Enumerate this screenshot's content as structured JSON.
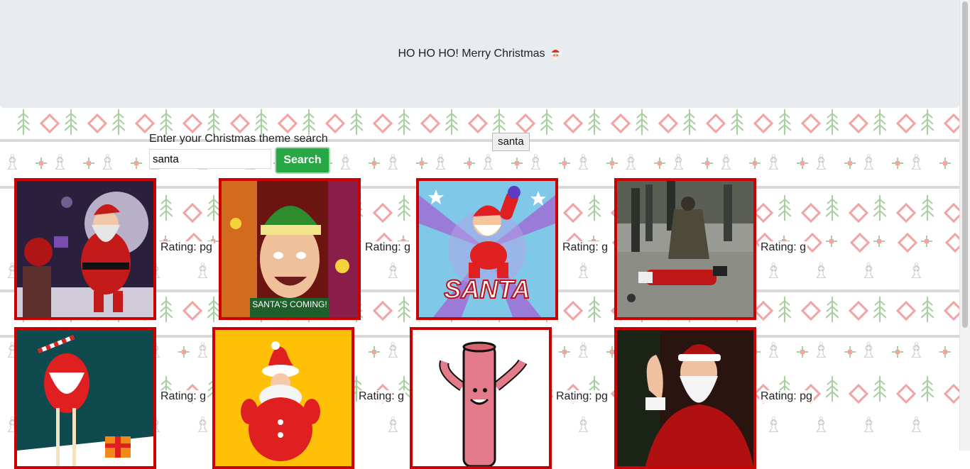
{
  "header": {
    "title": "HO HO HO! Merry Christmas"
  },
  "search": {
    "label": "Enter your Christmas theme search",
    "value": "santa",
    "button_label": "Search"
  },
  "topics": [
    "santa"
  ],
  "results": [
    {
      "rating": "Rating: pg",
      "caption": ""
    },
    {
      "rating": "Rating: g",
      "caption": "SANTA'S COMING!"
    },
    {
      "rating": "Rating: g",
      "caption": "SANTA"
    },
    {
      "rating": "Rating: g",
      "caption": ""
    },
    {
      "rating": "Rating: g",
      "caption": ""
    },
    {
      "rating": "Rating: g",
      "caption": ""
    },
    {
      "rating": "Rating: pg",
      "caption": ""
    },
    {
      "rating": "Rating: pg",
      "caption": ""
    }
  ],
  "colors": {
    "jumbotron": "#e9ecef",
    "search_button": "#28a745",
    "gif_border": "#cc0000",
    "sweater_green": "#a8cfa0",
    "sweater_red": "#f2a3a3"
  }
}
